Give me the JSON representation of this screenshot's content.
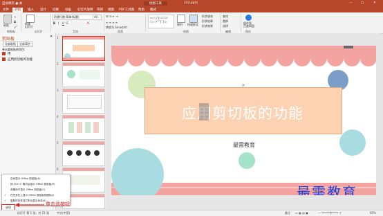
{
  "titlebar": {
    "left": "自动保存 ● 关",
    "center": "绘图工具",
    "file": "222.pptx",
    "controls": [
      "—",
      "□",
      "✕"
    ]
  },
  "tabs": [
    "文件",
    "开始",
    "插入",
    "设计",
    "切换",
    "动画",
    "幻灯片放映",
    "审阅",
    "视图",
    "PDF工具集",
    "帮助",
    "格式"
  ],
  "active_tab": "开始",
  "ribbon": {
    "paste": "粘贴",
    "new_slide": "新建\n幻灯片",
    "font_name": "仿建行楷-简体(标题)",
    "font_size": "40",
    "groups": [
      "剪贴板",
      "幻灯片",
      "字体",
      "段落",
      "绘图",
      "编辑",
      "保存"
    ],
    "draw_items": [
      "形状填充",
      "形状轮廓",
      "形状效果"
    ],
    "edit_items": [
      "查找",
      "替换",
      "选择"
    ],
    "arrange": "排列",
    "quick_styles": "快速样式",
    "save_label": "保存到\n百度网盘",
    "smartart": "转换为 SmartArt"
  },
  "clipboard_pane": {
    "title": "剪贴板",
    "paste_all": "全部粘贴",
    "clear_all": "全部清空",
    "hint": "单击要粘贴的项目:",
    "items": [
      "用",
      "应用剪切板的功能"
    ]
  },
  "thumbs": [
    "1",
    "2",
    "3",
    "4",
    "5",
    "6",
    "7"
  ],
  "slide": {
    "title": "应用剪切板的功能",
    "subtitle": "最需教育",
    "watermark": "最需教育"
  },
  "menu": {
    "items": [
      "自动显示 Office 剪贴板(A)",
      "按 Ctrl+C 两次后显示 Office 剪贴板(P)",
      "收集而不显示 Office 剪贴板(C)",
      "在任务栏上显示 Office 剪贴板的图标(I)",
      "复制时在任务栏附近显示状态(S)"
    ],
    "checked": [
      false,
      false,
      false,
      true,
      true
    ],
    "options_button": "选项"
  },
  "annotation": "单击该按钮",
  "status": {
    "slide": "幻灯片 第 1 张，共 21 张",
    "lang": "中文(中国)",
    "notes": "备注",
    "zoom": "60%"
  },
  "colors": {
    "accent": "#b7472a",
    "scallop": "#f4a4a0",
    "title_box": "#fcd2b3",
    "circle_green": "#d7ebbf",
    "circle_blue": "#7b9ec9",
    "circle_teal": "#a8dce0",
    "circle_mint": "#a5e3c8",
    "annotation_red": "#e02020",
    "watermark_blue": "#1f3fd6"
  }
}
